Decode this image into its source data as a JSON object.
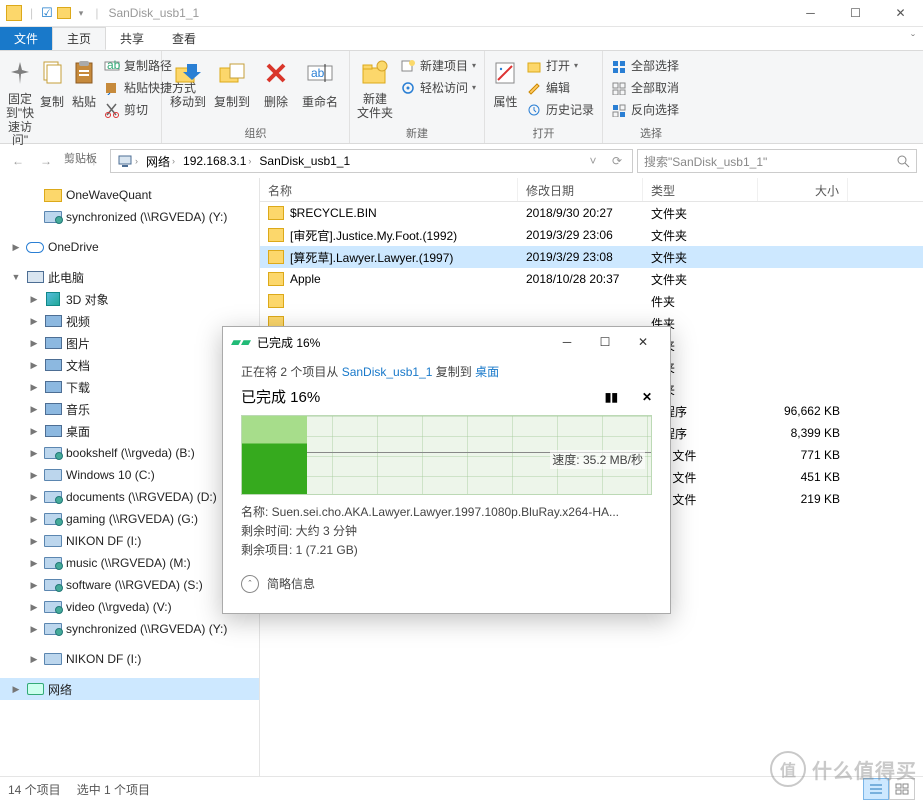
{
  "titlebar": {
    "title": "SanDisk_usb1_1"
  },
  "tabs": {
    "file": "文件",
    "home": "主页",
    "share": "共享",
    "view": "查看"
  },
  "ribbon": {
    "pin": "固定到\"快\n速访问\"",
    "copy": "复制",
    "paste": "粘贴",
    "copy_path": "复制路径",
    "paste_shortcut": "粘贴快捷方式",
    "cut": "剪切",
    "group_clipboard": "剪贴板",
    "move_to": "移动到",
    "copy_to": "复制到",
    "delete": "删除",
    "rename": "重命名",
    "group_organize": "组织",
    "new_folder": "新建\n文件夹",
    "new_item": "新建项目",
    "easy_access": "轻松访问",
    "group_new": "新建",
    "properties": "属性",
    "open": "打开",
    "edit": "编辑",
    "history": "历史记录",
    "group_open": "打开",
    "select_all": "全部选择",
    "select_none": "全部取消",
    "invert_sel": "反向选择",
    "group_select": "选择"
  },
  "address": {
    "root": "网络",
    "ip": "192.168.3.1",
    "folder": "SanDisk_usb1_1"
  },
  "search": {
    "placeholder": "搜索\"SanDisk_usb1_1\""
  },
  "tree": [
    {
      "indent": 28,
      "icon": "folder",
      "label": "OneWaveQuant",
      "exp": ""
    },
    {
      "indent": 28,
      "icon": "net",
      "label": "synchronized (\\\\RGVEDA) (Y:)",
      "exp": ""
    },
    {
      "indent": 10,
      "icon": "",
      "label": "",
      "exp": ""
    },
    {
      "indent": 10,
      "icon": "cloud",
      "label": "OneDrive",
      "exp": "▶"
    },
    {
      "indent": 10,
      "icon": "",
      "label": "",
      "exp": ""
    },
    {
      "indent": 10,
      "icon": "pc",
      "label": "此电脑",
      "exp": "▼"
    },
    {
      "indent": 28,
      "icon": "obj3d",
      "label": "3D 对象",
      "exp": "▶"
    },
    {
      "indent": 28,
      "icon": "blue",
      "label": "视频",
      "exp": "▶"
    },
    {
      "indent": 28,
      "icon": "blue",
      "label": "图片",
      "exp": "▶"
    },
    {
      "indent": 28,
      "icon": "blue",
      "label": "文档",
      "exp": "▶"
    },
    {
      "indent": 28,
      "icon": "blue",
      "label": "下载",
      "exp": "▶"
    },
    {
      "indent": 28,
      "icon": "blue",
      "label": "音乐",
      "exp": "▶"
    },
    {
      "indent": 28,
      "icon": "blue",
      "label": "桌面",
      "exp": "▶"
    },
    {
      "indent": 28,
      "icon": "net",
      "label": "bookshelf (\\\\rgveda) (B:)",
      "exp": "▶"
    },
    {
      "indent": 28,
      "icon": "drive",
      "label": "Windows 10 (C:)",
      "exp": "▶"
    },
    {
      "indent": 28,
      "icon": "net",
      "label": "documents (\\\\RGVEDA) (D:)",
      "exp": "▶"
    },
    {
      "indent": 28,
      "icon": "net",
      "label": "gaming (\\\\RGVEDA) (G:)",
      "exp": "▶"
    },
    {
      "indent": 28,
      "icon": "drive",
      "label": "NIKON DF (I:)",
      "exp": "▶"
    },
    {
      "indent": 28,
      "icon": "net",
      "label": "music (\\\\RGVEDA) (M:)",
      "exp": "▶"
    },
    {
      "indent": 28,
      "icon": "net",
      "label": "software (\\\\RGVEDA) (S:)",
      "exp": "▶"
    },
    {
      "indent": 28,
      "icon": "net",
      "label": "video (\\\\rgveda) (V:)",
      "exp": "▶"
    },
    {
      "indent": 28,
      "icon": "net",
      "label": "synchronized (\\\\RGVEDA) (Y:)",
      "exp": "▶"
    },
    {
      "indent": 10,
      "icon": "",
      "label": "",
      "exp": ""
    },
    {
      "indent": 28,
      "icon": "drive",
      "label": "NIKON DF (I:)",
      "exp": "▶"
    },
    {
      "indent": 10,
      "icon": "",
      "label": "",
      "exp": ""
    },
    {
      "indent": 10,
      "icon": "netg",
      "label": "网络",
      "exp": "▶",
      "sel": true
    }
  ],
  "columns": {
    "name": "名称",
    "date": "修改日期",
    "type": "类型",
    "size": "大小"
  },
  "rows": [
    {
      "icon": "folder",
      "name": "$RECYCLE.BIN",
      "date": "2018/9/30 20:27",
      "type": "文件夹",
      "size": "",
      "sel": false
    },
    {
      "icon": "folder",
      "name": "[审死官].Justice.My.Foot.(1992)",
      "date": "2019/3/29 23:06",
      "type": "文件夹",
      "size": "",
      "sel": false
    },
    {
      "icon": "folder",
      "name": "[算死草].Lawyer.Lawyer.(1997)",
      "date": "2019/3/29 23:08",
      "type": "文件夹",
      "size": "",
      "sel": true
    },
    {
      "icon": "folder",
      "name": "Apple",
      "date": "2018/10/28 20:37",
      "type": "文件夹",
      "size": "",
      "sel": false
    },
    {
      "icon": "folder",
      "name": "",
      "date": "",
      "type": "件夹",
      "size": "",
      "sel": false
    },
    {
      "icon": "folder",
      "name": "",
      "date": "",
      "type": "件夹",
      "size": "",
      "sel": false
    },
    {
      "icon": "folder",
      "name": "",
      "date": "",
      "type": "件夹",
      "size": "",
      "sel": false
    },
    {
      "icon": "folder",
      "name": "",
      "date": "",
      "type": "件夹",
      "size": "",
      "sel": false
    },
    {
      "icon": "folder",
      "name": "",
      "date": "",
      "type": "件夹",
      "size": "",
      "sel": false
    },
    {
      "icon": "file",
      "name": "",
      "date": "",
      "type": "用程序",
      "size": "96,662 KB",
      "sel": false
    },
    {
      "icon": "file",
      "name": "",
      "date": "",
      "type": "用程序",
      "size": "8,399 KB",
      "sel": false
    },
    {
      "icon": "png",
      "name": "",
      "date": "",
      "type": "NG 文件",
      "size": "771 KB",
      "sel": false
    },
    {
      "icon": "png",
      "name": "",
      "date": "",
      "type": "NG 文件",
      "size": "451 KB",
      "sel": false
    },
    {
      "icon": "png",
      "name": "",
      "date": "",
      "type": "NG 文件",
      "size": "219 KB",
      "sel": false
    }
  ],
  "status": {
    "items": "14 个项目",
    "selected": "选中 1 个项目"
  },
  "dialog": {
    "title": "已完成 16%",
    "copying_prefix": "正在将 2 个项目从 ",
    "src": "SanDisk_usb1_1",
    "mid": " 复制到 ",
    "dst": "桌面",
    "progress": "已完成 16%",
    "speed": "速度: 35.2 MB/秒",
    "name": "名称: Suen.sei.cho.AKA.Lawyer.Lawyer.1997.1080p.BluRay.x264-HA...",
    "time": "剩余时间: 大约 3 分钟",
    "remain": "剩余项目: 1 (7.21 GB)",
    "toggle": "简略信息"
  },
  "watermark": "什么值得买"
}
